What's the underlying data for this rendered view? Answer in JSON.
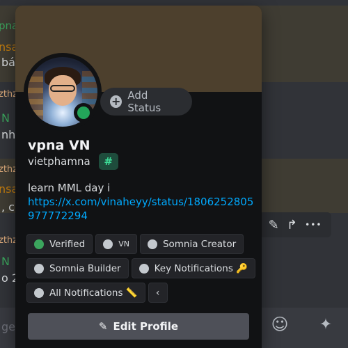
{
  "background": {
    "fragments": [
      {
        "text": "pna",
        "color": "#3ba55d"
      },
      {
        "text": "nsa",
        "color": "#c27c0e"
      },
      {
        "text": "bá",
        "color": "#dbdee1"
      },
      {
        "text": "zthz",
        "color": "#dba97a"
      },
      {
        "text": "N",
        "color": "#3ba55d"
      },
      {
        "text": "nh",
        "color": "#dbdee1"
      },
      {
        "text": "zthz",
        "color": "#dba97a"
      },
      {
        "text": "nsa",
        "color": "#c27c0e"
      },
      {
        "text": ", cu",
        "color": "#dbdee1"
      },
      {
        "text": "zthz",
        "color": "#dba97a"
      },
      {
        "text": "N",
        "color": "#3ba55d"
      },
      {
        "text": "o 2",
        "color": "#dbdee1"
      },
      {
        "text": "ge",
        "color": "#6d6f78"
      }
    ]
  },
  "profile": {
    "display_name": "vpna VN",
    "username": "vietphamna",
    "badge_icon": "hash-badge",
    "add_status_label": "Add Status",
    "bio_line": "learn MML day i",
    "bio_link": "https://x.com/vinaheyy/status/1806252805977772294",
    "status": "online",
    "banner_color": "#4d402d"
  },
  "roles": [
    {
      "label": "Verified",
      "dot": "green"
    },
    {
      "label": "VN",
      "dot": "gray",
      "small": true
    },
    {
      "label": "Somnia Creator",
      "dot": "gray"
    },
    {
      "label": "Somnia Builder",
      "dot": "gray"
    },
    {
      "label": "Key Notifications 🔑",
      "dot": "gray"
    },
    {
      "label": "All Notifications 📏",
      "dot": "gray"
    }
  ],
  "roles_more_glyph": "‹",
  "edit_profile_label": "Edit Profile",
  "icons": {
    "edit": "✎",
    "share": "↱",
    "more": "•••",
    "emoji": "☺",
    "apps": "✦"
  }
}
